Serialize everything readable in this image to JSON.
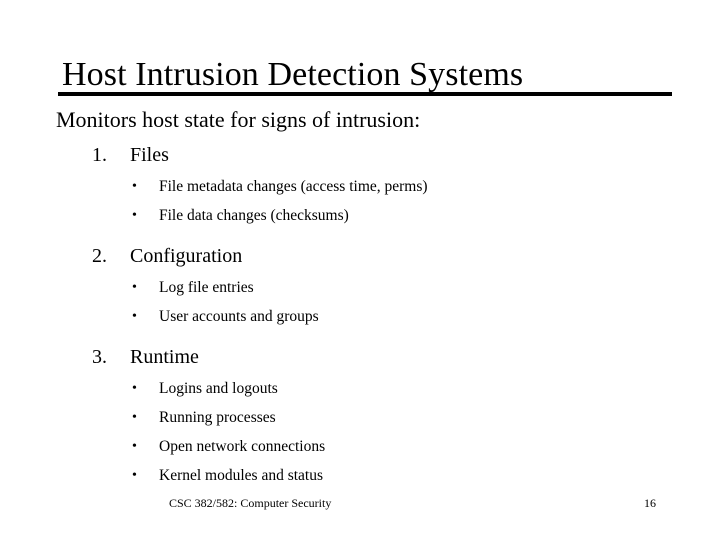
{
  "slide": {
    "title": "Host Intrusion Detection Systems",
    "lead": "Monitors host state for signs of intrusion:",
    "rule_color": "#000000",
    "background_color": "#ffffff",
    "text_color": "#000000"
  },
  "outline": {
    "bullet_glyph": "•",
    "items": [
      {
        "number": "1.",
        "label": "Files",
        "sub_items": [
          "File metadata changes (access time, perms)",
          "File data changes (checksums)"
        ]
      },
      {
        "number": "2.",
        "label": "Configuration",
        "sub_items": [
          "Log file entries",
          "User accounts and groups"
        ]
      },
      {
        "number": "3.",
        "label": "Runtime",
        "sub_items": [
          "Logins and logouts",
          "Running processes",
          "Open network connections",
          "Kernel modules and status"
        ]
      }
    ]
  },
  "footer": {
    "course": "CSC 382/582: Computer Security",
    "page_number": "16"
  }
}
